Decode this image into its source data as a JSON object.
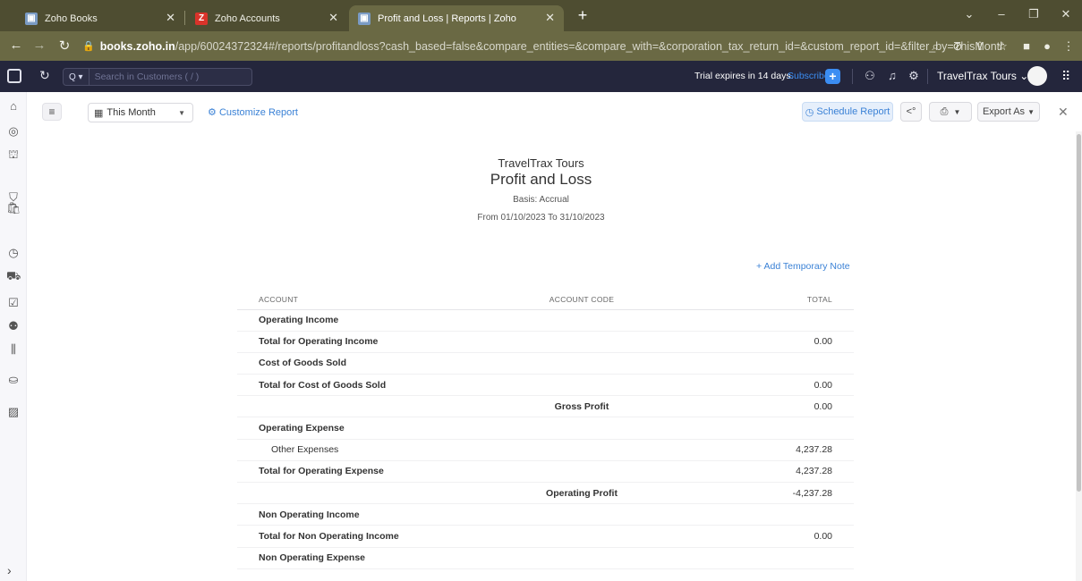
{
  "browser": {
    "tabs": [
      {
        "title": "Zoho Books",
        "active": false
      },
      {
        "title": "Zoho Accounts",
        "active": false
      },
      {
        "title": "Profit and Loss | Reports | Zoho",
        "active": true
      }
    ],
    "url_host": "books.zoho.in",
    "url_path": "/app/60024372324#/reports/profitandloss?cash_based=false&compare_entities=&compare_with=&corporation_tax_return_id=&custom_report_id=&filter_by=ThisMonth..."
  },
  "header": {
    "search_placeholder": "Search in Customers ( / )",
    "trial_text": "Trial expires in 14 days.",
    "subscribe_label": "Subscribe",
    "org_name": "TravelTrax Tours"
  },
  "toolbar": {
    "period": "This Month",
    "customize_label": "Customize Report",
    "schedule_label": "Schedule Report",
    "export_label": "Export As"
  },
  "report": {
    "org": "TravelTrax Tours",
    "title": "Profit and Loss",
    "basis": "Basis: Accrual",
    "range": "From 01/10/2023 To 31/10/2023",
    "add_note": "+ Add Temporary Note",
    "columns": {
      "account": "ACCOUNT",
      "code": "ACCOUNT CODE",
      "total": "TOTAL"
    },
    "rows": [
      {
        "account": "Operating Income",
        "code": "",
        "total": "",
        "type": "section"
      },
      {
        "account": "Total for Operating Income",
        "code": "",
        "total": "0.00",
        "type": "total"
      },
      {
        "account": "Cost of Goods Sold",
        "code": "",
        "total": "",
        "type": "section"
      },
      {
        "account": "Total for Cost of Goods Sold",
        "code": "",
        "total": "0.00",
        "type": "total"
      },
      {
        "account": "",
        "code": "Gross Profit",
        "total": "0.00",
        "type": "profit"
      },
      {
        "account": "Operating Expense",
        "code": "",
        "total": "",
        "type": "section"
      },
      {
        "account": "Other Expenses",
        "code": "",
        "total": "4,237.28",
        "type": "link"
      },
      {
        "account": "Total for Operating Expense",
        "code": "",
        "total": "4,237.28",
        "type": "total"
      },
      {
        "account": "",
        "code": "Operating Profit",
        "total": "-4,237.28",
        "type": "profit"
      },
      {
        "account": "Non Operating Income",
        "code": "",
        "total": "",
        "type": "section"
      },
      {
        "account": "Total for Non Operating Income",
        "code": "",
        "total": "0.00",
        "type": "total"
      },
      {
        "account": "Non Operating Expense",
        "code": "",
        "total": "",
        "type": "section"
      }
    ]
  },
  "colors": {
    "tabstrip": "#4e4d31",
    "addressbar": "#6a6944",
    "app_header": "#24263c",
    "accent": "#3b82d6"
  }
}
